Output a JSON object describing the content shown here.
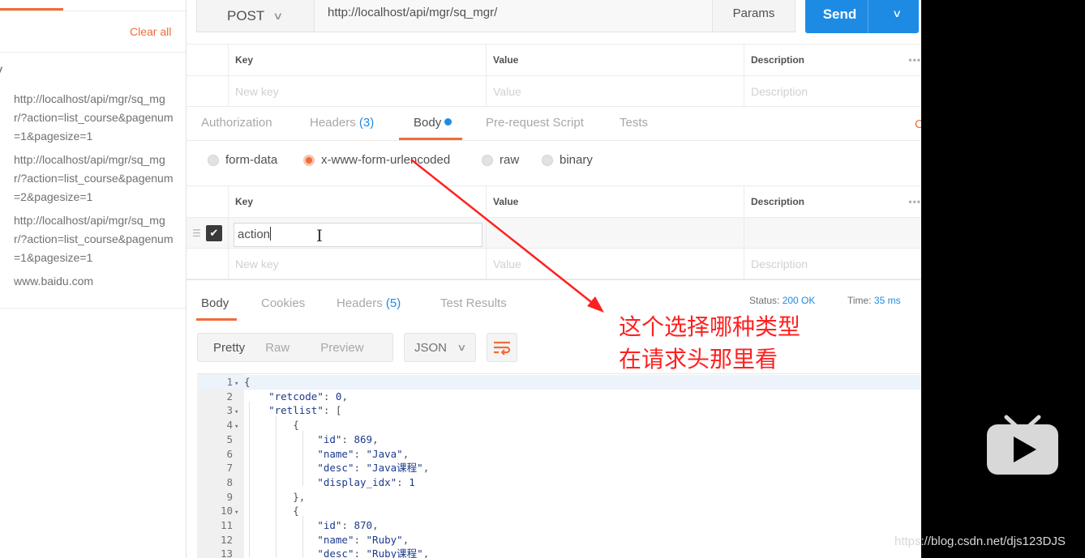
{
  "sidebar": {
    "clear_all": "Clear all",
    "group_label": "y",
    "history": [
      "http://localhost/api/mgr/sq_mgr/?action=list_course&pagenum=1&pagesize=1",
      "http://localhost/api/mgr/sq_mgr/?action=list_course&pagenum=2&pagesize=1",
      "http://localhost/api/mgr/sq_mgr/?action=list_course&pagenum=1&pagesize=1",
      "www.baidu.com"
    ]
  },
  "request": {
    "method": "POST",
    "url": "http://localhost/api/mgr/sq_mgr/",
    "params_label": "Params",
    "send_label": "Send"
  },
  "params_table": {
    "headers": {
      "key": "Key",
      "value": "Value",
      "description": "Description"
    },
    "placeholders": {
      "key": "New key",
      "value": "Value",
      "description": "Description"
    }
  },
  "request_tabs": {
    "authorization": "Authorization",
    "headers": "Headers",
    "headers_count": "(3)",
    "body": "Body",
    "pre_request": "Pre-request Script",
    "tests": "Tests",
    "right_edge": "C"
  },
  "body_types": {
    "form_data": "form-data",
    "urlencoded": "x-www-form-urlencoded",
    "raw": "raw",
    "binary": "binary"
  },
  "body_table": {
    "headers": {
      "key": "Key",
      "value": "Value",
      "description": "Description"
    },
    "row_key": "action",
    "placeholders": {
      "key": "New key",
      "value": "Value",
      "description": "Description"
    }
  },
  "response": {
    "tabs": {
      "body": "Body",
      "cookies": "Cookies",
      "headers": "Headers",
      "headers_count": "(5)",
      "tests": "Test Results"
    },
    "status_label": "Status:",
    "status_value": "200 OK",
    "time_label": "Time:",
    "time_value": "35 ms",
    "formats": {
      "pretty": "Pretty",
      "raw": "Raw",
      "preview": "Preview"
    },
    "language": "JSON",
    "code_lines": [
      "{",
      "    \"retcode\": 0,",
      "    \"retlist\": [",
      "        {",
      "            \"id\": 869,",
      "            \"name\": \"Java\",",
      "            \"desc\": \"Java课程\",",
      "            \"display_idx\": 1",
      "        },",
      "        {",
      "            \"id\": 870,",
      "            \"name\": \"Ruby\",",
      "            \"desc\": \"Ruby课程\","
    ],
    "fold_lines": [
      1,
      3,
      4,
      10
    ]
  },
  "annotation": {
    "line1": "这个选择哪种类型",
    "line2": "在请求头那里看",
    "color": "#ff2020"
  },
  "watermark": "https://blog.csdn.net/djs123DJS",
  "colors": {
    "accent": "#f26b3a",
    "send": "#1d8be4"
  }
}
